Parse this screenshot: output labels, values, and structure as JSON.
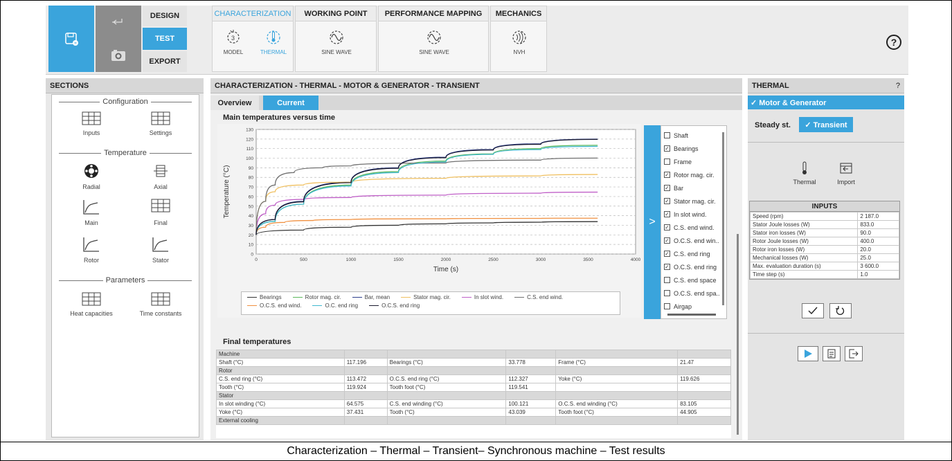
{
  "toolbar": {
    "modes": [
      "DESIGN",
      "TEST",
      "EXPORT"
    ],
    "active_mode": "TEST",
    "groups": [
      {
        "title": "CHARACTERIZATION",
        "tools": [
          "MODEL",
          "THERMAL"
        ]
      },
      {
        "title": "WORKING POINT",
        "tools": [
          "SINE WAVE"
        ]
      },
      {
        "title": "PERFORMANCE MAPPING",
        "tools": [
          "SINE WAVE"
        ]
      },
      {
        "title": "MECHANICS",
        "tools": [
          "NVH"
        ]
      }
    ],
    "help": "?"
  },
  "sections": {
    "title": "SECTIONS",
    "groups": [
      {
        "label": "Configuration",
        "items": [
          "Inputs",
          "Settings"
        ]
      },
      {
        "label": "Temperature",
        "items": [
          "Radial",
          "Axial",
          "Main",
          "Final",
          "Rotor",
          "Stator"
        ]
      },
      {
        "label": "Parameters",
        "items": [
          "Heat capacities",
          "Time constants"
        ]
      }
    ]
  },
  "main": {
    "breadcrumb": "CHARACTERIZATION - THERMAL - MOTOR & GENERATOR - TRANSIENT",
    "tabs": [
      "Overview",
      "Current"
    ],
    "chart_title": "Main temperatures versus time",
    "final_title": "Final temperatures",
    "expand_glyph": ">"
  },
  "chart_data": {
    "type": "line",
    "title": "Main temperatures versus time",
    "xlabel": "Time (s)",
    "ylabel": "Temperature (°C)",
    "xlim": [
      0,
      4000
    ],
    "ylim": [
      0,
      130
    ],
    "xticks": [
      0,
      500,
      1000,
      1500,
      2000,
      2500,
      3000,
      3500,
      4000
    ],
    "yticks": [
      0,
      10,
      20,
      30,
      40,
      50,
      60,
      70,
      80,
      90,
      100,
      110,
      120,
      130
    ],
    "grid": "dashed horizontal",
    "series": [
      {
        "name": "Bearings",
        "color": "#333333",
        "values": [
          [
            0,
            20
          ],
          [
            500,
            25
          ],
          [
            1000,
            28
          ],
          [
            1500,
            30
          ],
          [
            2000,
            31.5
          ],
          [
            2500,
            32.5
          ],
          [
            3000,
            33.2
          ],
          [
            3600,
            33.8
          ]
        ]
      },
      {
        "name": "Rotor mag. cir.",
        "color": "#5cb85c",
        "values": [
          [
            0,
            20
          ],
          [
            200,
            34
          ],
          [
            500,
            52
          ],
          [
            1000,
            72
          ],
          [
            1500,
            86
          ],
          [
            2000,
            97
          ],
          [
            2500,
            104.5
          ],
          [
            3000,
            110
          ],
          [
            3600,
            113.5
          ]
        ]
      },
      {
        "name": "Bar, mean",
        "color": "#2d3e8c",
        "values": [
          [
            0,
            20
          ],
          [
            200,
            36
          ],
          [
            500,
            55
          ],
          [
            1000,
            75
          ],
          [
            1500,
            90
          ],
          [
            2000,
            101
          ],
          [
            2500,
            109
          ],
          [
            3000,
            115
          ],
          [
            3600,
            119.9
          ]
        ]
      },
      {
        "name": "Stator mag. cir.",
        "color": "#f0c060",
        "values": [
          [
            0,
            20
          ],
          [
            100,
            55
          ],
          [
            200,
            65
          ],
          [
            500,
            72
          ],
          [
            1000,
            75
          ],
          [
            2000,
            79
          ],
          [
            3000,
            81.5
          ],
          [
            3600,
            83
          ]
        ]
      },
      {
        "name": "In slot wind.",
        "color": "#c060c8",
        "values": [
          [
            0,
            20
          ],
          [
            100,
            42
          ],
          [
            200,
            51
          ],
          [
            500,
            57
          ],
          [
            1000,
            59
          ],
          [
            2000,
            61.5
          ],
          [
            3000,
            63.5
          ],
          [
            3600,
            64.6
          ]
        ]
      },
      {
        "name": "C.S. end wind.",
        "color": "#707070",
        "values": [
          [
            0,
            20
          ],
          [
            100,
            55
          ],
          [
            200,
            72
          ],
          [
            400,
            85
          ],
          [
            700,
            90
          ],
          [
            1000,
            92
          ],
          [
            2000,
            95
          ],
          [
            3000,
            98
          ],
          [
            3600,
            100.1
          ]
        ]
      },
      {
        "name": "O.C.S. end wind.",
        "color": "#f09040",
        "values": [
          [
            0,
            20
          ],
          [
            100,
            28
          ],
          [
            300,
            33
          ],
          [
            600,
            35
          ],
          [
            1000,
            36
          ],
          [
            2000,
            36.8
          ],
          [
            3000,
            37.2
          ],
          [
            3600,
            37.4
          ]
        ]
      },
      {
        "name": "O.C. end ring",
        "color": "#40b8d0",
        "values": [
          [
            0,
            20
          ],
          [
            200,
            34
          ],
          [
            500,
            52
          ],
          [
            1000,
            71
          ],
          [
            1500,
            85
          ],
          [
            2000,
            96
          ],
          [
            2500,
            104
          ],
          [
            3000,
            109
          ],
          [
            3600,
            112.3
          ]
        ]
      },
      {
        "name": "O.C.S. end ring",
        "color": "#1a1a2e",
        "values": [
          [
            0,
            20
          ],
          [
            200,
            36
          ],
          [
            500,
            54.5
          ],
          [
            1000,
            74.5
          ],
          [
            1500,
            89.5
          ],
          [
            2000,
            100.5
          ],
          [
            2500,
            108.5
          ],
          [
            3000,
            114.5
          ],
          [
            3600,
            119.6
          ]
        ]
      }
    ]
  },
  "legend_rows": [
    [
      "Bearings",
      "Rotor mag. cir.",
      "Bar, mean",
      "Stator mag. cir.",
      "In slot wind.",
      "C.S. end wind."
    ],
    [
      "O.C.S. end wind.",
      "O.C. end ring",
      "O.C.S. end ring"
    ]
  ],
  "selector": [
    {
      "label": "Shaft",
      "checked": false
    },
    {
      "label": "Bearings",
      "checked": true
    },
    {
      "label": "Frame",
      "checked": false
    },
    {
      "label": "Rotor mag. cir.",
      "checked": true
    },
    {
      "label": "Bar",
      "checked": true
    },
    {
      "label": "Stator mag. cir.",
      "checked": true
    },
    {
      "label": "In slot wind.",
      "checked": true
    },
    {
      "label": "C.S. end wind.",
      "checked": true
    },
    {
      "label": "O.C.S. end win..",
      "checked": true
    },
    {
      "label": "C.S. end ring",
      "checked": true
    },
    {
      "label": "O.C.S. end ring",
      "checked": true
    },
    {
      "label": "C.S. end space",
      "checked": false
    },
    {
      "label": "O.C.S. end spa..",
      "checked": false
    },
    {
      "label": "Airgap",
      "checked": false
    }
  ],
  "final_table": [
    {
      "group": "Machine"
    },
    {
      "cells": [
        "Shaft (°C)",
        "117.196",
        "Bearings (°C)",
        "33.778",
        "Frame (°C)",
        "21.47"
      ]
    },
    {
      "group": "Rotor"
    },
    {
      "cells": [
        "C.S. end ring (°C)",
        "113.472",
        "O.C.S. end ring (°C)",
        "112.327",
        "Yoke (°C)",
        "119.626"
      ]
    },
    {
      "cells": [
        "Tooth (°C)",
        "119.924",
        "Tooth foot (°C)",
        "119.541",
        "",
        ""
      ]
    },
    {
      "group": "Stator"
    },
    {
      "cells": [
        "In slot winding (°C)",
        "64.575",
        "C.S. end winding (°C)",
        "100.121",
        "O.C.S. end winding (°C)",
        "83.105"
      ]
    },
    {
      "cells": [
        "Yoke (°C)",
        "37.431",
        "Tooth (°C)",
        "43.039",
        "Tooth foot (°C)",
        "44.905"
      ]
    },
    {
      "group": "External cooling"
    }
  ],
  "right": {
    "title": "THERMAL",
    "help": "?",
    "motor_generator": "✓ Motor & Generator",
    "steady": "Steady st.",
    "transient": "✓ Transient",
    "thermal": "Thermal",
    "import": "Import",
    "inputs_title": "INPUTS",
    "inputs": [
      [
        "Speed (rpm)",
        "2 187.0"
      ],
      [
        "Stator Joule losses (W)",
        "833.0"
      ],
      [
        "Stator iron losses (W)",
        "90.0"
      ],
      [
        "Rotor Joule losses (W)",
        "400.0"
      ],
      [
        "Rotor iron losses (W)",
        "20.0"
      ],
      [
        "Mechanical losses (W)",
        "25.0"
      ],
      [
        "Max. evaluation duration (s)",
        "3 600.0"
      ],
      [
        "Time step (s)",
        "1.0"
      ]
    ]
  },
  "caption": "Characterization – Thermal – Transient– Synchronous machine – Test results"
}
